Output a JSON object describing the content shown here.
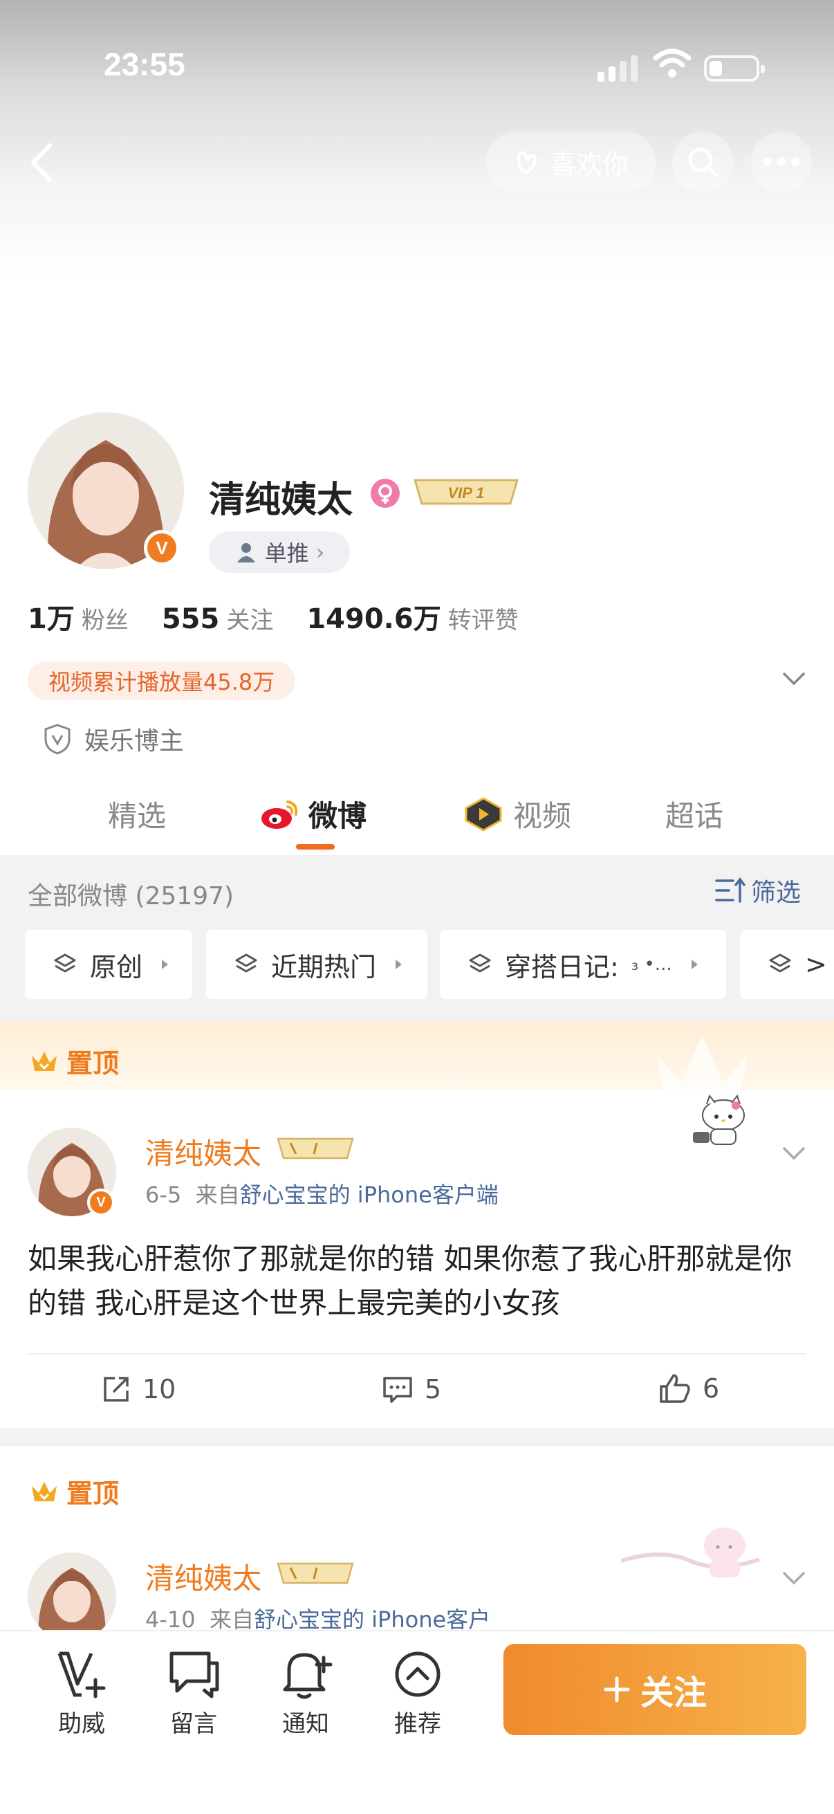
{
  "status_bar": {
    "time": "23:55"
  },
  "header": {
    "like_label": "喜欢你"
  },
  "profile": {
    "name": "清纯姨太",
    "vip_label": "VIP 1",
    "tag_label": "单推",
    "stats": [
      {
        "num": "1万",
        "label": "粉丝"
      },
      {
        "num": "555",
        "label": "关注"
      },
      {
        "num": "1490.6万",
        "label": "转评赞"
      }
    ],
    "plays": "视频累计播放量45.8万",
    "role": "娱乐博主"
  },
  "tabs": [
    {
      "label": "精选"
    },
    {
      "label": "微博"
    },
    {
      "label": "视频"
    },
    {
      "label": "超话"
    }
  ],
  "feed": {
    "header": "全部微博 (25197)",
    "filter_label": "筛选",
    "chips": [
      {
        "label": "原创"
      },
      {
        "label": "近期热门"
      },
      {
        "label": "穿搭日记:"
      },
      {
        "label": ">"
      }
    ],
    "chip_extra": "₃ •...",
    "posts": [
      {
        "pin_label": "置顶",
        "name": "清纯姨太",
        "date": "6-5",
        "from": "来自",
        "source": "舒心宝宝的 iPhone客户端",
        "text": "如果我心肝惹你了那就是你的错 如果你惹了我心肝那就是你的错 我心肝是这个世界上最完美的小女孩",
        "reposts": "10",
        "comments": "5",
        "likes": "6"
      },
      {
        "pin_label": "置顶",
        "name": "清纯姨太",
        "date": "4-10",
        "from": "来自",
        "source": "舒心宝宝的 iPhone客户"
      }
    ]
  },
  "bottom_nav": {
    "items": [
      {
        "label": "助威"
      },
      {
        "label": "留言"
      },
      {
        "label": "通知"
      },
      {
        "label": "推荐"
      }
    ],
    "follow_label": "关注"
  },
  "colors": {
    "accent_orange": "#ef7b1d",
    "link_blue": "#4a6a9a",
    "follow_gradient_start": "#f08a2e",
    "follow_gradient_end": "#f6b24a"
  }
}
